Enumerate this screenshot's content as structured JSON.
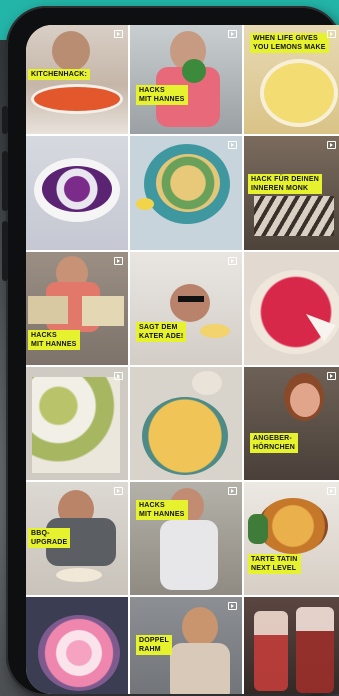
{
  "colors": {
    "brand_teal": "#23b5a8",
    "caption_yellow": "#e6f22e",
    "phone_body": "#0e0f10"
  },
  "tiles": [
    {
      "id": "kitchenhack",
      "caption": "KITCHENHACK:",
      "icon": "reel-icon"
    },
    {
      "id": "hacks-mit-hannes-1",
      "caption": "HACKS\nMIT HANNES",
      "icon": "reel-icon"
    },
    {
      "id": "lemons",
      "caption": "WHEN LIFE GIVES\nYOU LEMONS MAKE",
      "subcaption": "",
      "icon": "reel-icon"
    },
    {
      "id": "blue-dish",
      "caption": "",
      "icon": ""
    },
    {
      "id": "pasta-plate",
      "caption": "",
      "icon": "reel-icon"
    },
    {
      "id": "inner-monk",
      "caption": "HACK FÜR DEINEN\nINNEREN MONK",
      "icon": "reel-icon"
    },
    {
      "id": "hacks-mit-hannes-2",
      "caption": "HACKS\nMIT HANNES",
      "icon": "reel-icon"
    },
    {
      "id": "kater-ade",
      "caption": "SAGT DEM\nKATER ADE!",
      "icon": "reel-icon"
    },
    {
      "id": "red-tart",
      "caption": "",
      "icon": ""
    },
    {
      "id": "veg-tray",
      "caption": "",
      "icon": "reel-icon"
    },
    {
      "id": "quiche",
      "caption": "",
      "icon": ""
    },
    {
      "id": "angerhornchen",
      "caption": "ANGEBER-\nHÖRNCHEN",
      "subcaption": "",
      "icon": "reel-icon"
    },
    {
      "id": "bbq-upgrade",
      "caption": "BBQ-\nUPGRADE",
      "icon": "reel-icon"
    },
    {
      "id": "hacks-mit-hannes-3",
      "caption": "HACKS\nMIT HANNES",
      "icon": "reel-icon"
    },
    {
      "id": "tarte-tatin",
      "caption": "TARTE TATIN\nNEXT LEVEL",
      "icon": "reel-icon"
    },
    {
      "id": "marshmallows",
      "caption": "",
      "icon": ""
    },
    {
      "id": "doppel-rahm",
      "caption": "DOPPEL\nRAHM",
      "icon": "reel-icon"
    },
    {
      "id": "iced-drinks",
      "caption": "",
      "icon": ""
    }
  ]
}
